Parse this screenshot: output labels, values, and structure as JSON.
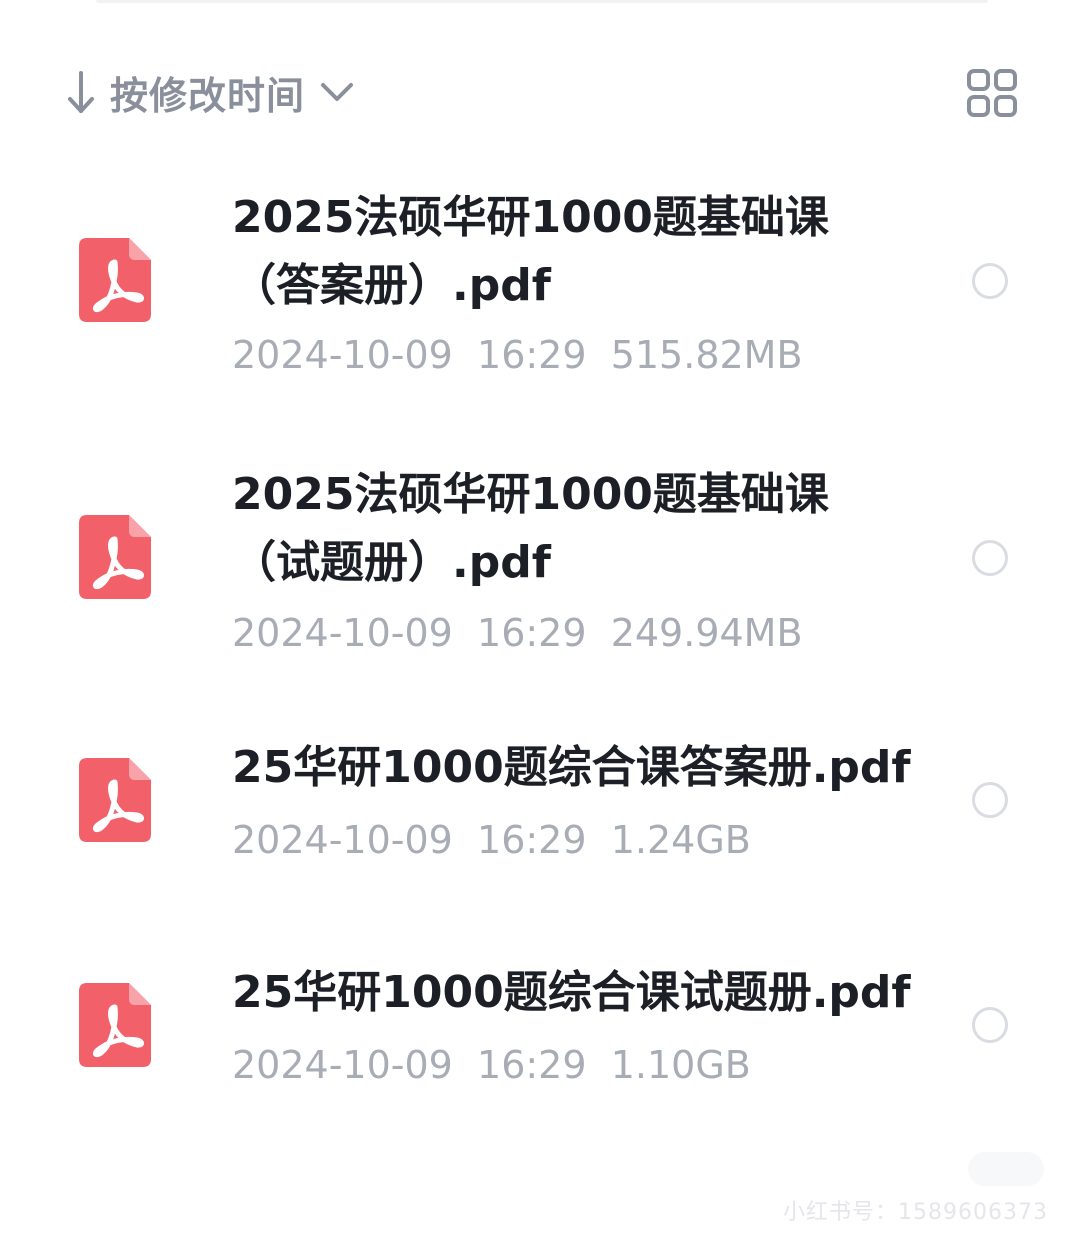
{
  "sort": {
    "label": "按修改时间",
    "direction_icon": "arrow-down-icon",
    "dropdown_icon": "chevron-down-icon"
  },
  "view_toggle": {
    "icon": "grid-view-icon"
  },
  "files": [
    {
      "name_line1": "2025法硕华研1000题基础课",
      "name_line2": "（答案册）.pdf",
      "date": "2024-10-09",
      "time": "16:29",
      "size": "515.82MB",
      "icon": "pdf-file-icon"
    },
    {
      "name_line1": "2025法硕华研1000题基础课",
      "name_line2": "（试题册）.pdf",
      "date": "2024-10-09",
      "time": "16:29",
      "size": "249.94MB",
      "icon": "pdf-file-icon"
    },
    {
      "name_line1": "25华研1000题综合课答案册.pdf",
      "date": "2024-10-09",
      "time": "16:29",
      "size": "1.24GB",
      "icon": "pdf-file-icon"
    },
    {
      "name_line1": "25华研1000题综合课试题册.pdf",
      "date": "2024-10-09",
      "time": "16:29",
      "size": "1.10GB",
      "icon": "pdf-file-icon"
    }
  ],
  "watermark": "小红书号：1589606373",
  "colors": {
    "pdf_red": "#f2606a",
    "text_primary": "#1c1f26",
    "text_secondary": "#a7acb5",
    "sort_gray": "#8a909b"
  }
}
